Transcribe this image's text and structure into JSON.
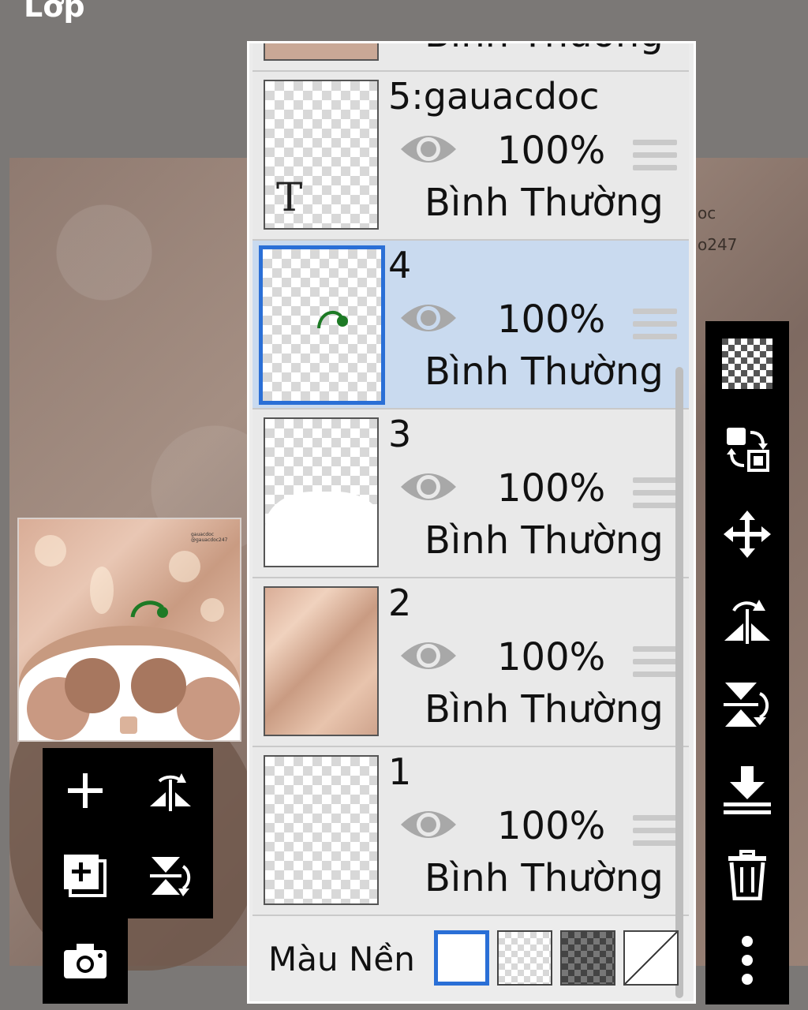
{
  "header": {
    "title": "Lớp"
  },
  "canvas_overlay": {
    "line1": "oc",
    "line2": "o247"
  },
  "thumbnail": {
    "caption_lines": [
      "gauacdoc",
      "@gauacdoc247"
    ]
  },
  "layers": [
    {
      "name": "",
      "opacity": "",
      "mode": "Bình Thường"
    },
    {
      "name": "5:gauacdoc",
      "opacity": "100%",
      "mode": "Bình Thường",
      "type_glyph": "T"
    },
    {
      "name": "4",
      "opacity": "100%",
      "mode": "Bình Thường",
      "selected": true
    },
    {
      "name": "3",
      "opacity": "100%",
      "mode": "Bình Thường"
    },
    {
      "name": "2",
      "opacity": "100%",
      "mode": "Bình Thường"
    },
    {
      "name": "1",
      "opacity": "100%",
      "mode": "Bình Thường"
    }
  ],
  "background": {
    "label": "Màu Nền",
    "options": [
      "white",
      "transparent",
      "dark-checker",
      "none"
    ],
    "selected": "white"
  },
  "left_toolbar": [
    "add-layer-icon",
    "flip-horizontal-icon",
    "add-copy-layer-icon",
    "flip-vertical-icon",
    "camera-icon"
  ],
  "right_toolbar": [
    "transparency-icon",
    "swap-layer-icon",
    "move-icon",
    "flip-horizontal-icon",
    "flip-vertical-icon",
    "merge-down-icon",
    "trash-icon",
    "more-icon"
  ],
  "colors": {
    "accent": "#2a6fd6",
    "selected_bg": "#c9daef",
    "panel_bg": "#ececec",
    "toolbar_bg": "#000000",
    "stroke_green": "#1d7a25"
  }
}
